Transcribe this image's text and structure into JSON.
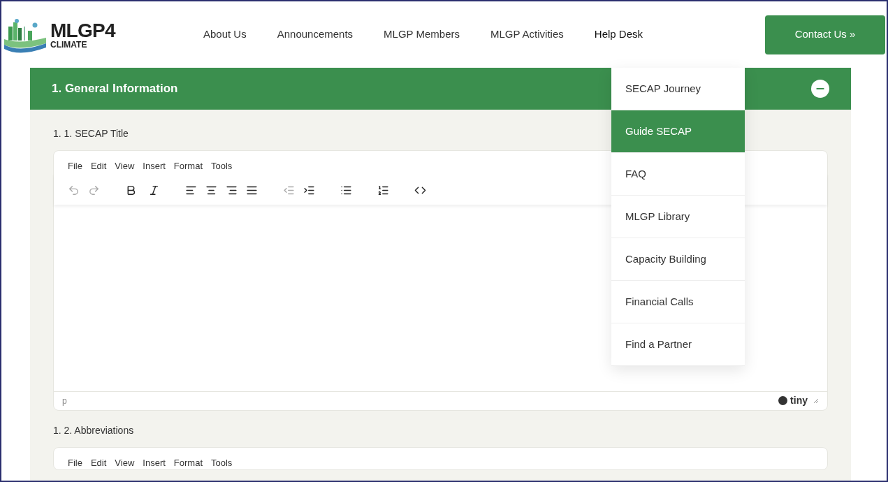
{
  "header": {
    "logo": {
      "title": "MLGP4",
      "subtitle": "CLIMATE"
    },
    "nav": [
      {
        "label": "About Us",
        "selected": false
      },
      {
        "label": "Announcements",
        "selected": false
      },
      {
        "label": "MLGP Members",
        "selected": false
      },
      {
        "label": "MLGP Activities",
        "selected": false
      },
      {
        "label": "Help Desk",
        "selected": true
      }
    ],
    "cta": {
      "label": "Contact Us »"
    }
  },
  "section": {
    "title": "1. General Information",
    "expanded": true
  },
  "fields": [
    {
      "label": "1. 1. SECAP Title",
      "editor": {
        "menu": [
          "File",
          "Edit",
          "View",
          "Insert",
          "Format",
          "Tools"
        ],
        "toolbar": [
          {
            "kind": "undo",
            "disabled": true
          },
          {
            "kind": "redo",
            "disabled": true
          },
          {
            "kind": "bold",
            "disabled": false
          },
          {
            "kind": "italic",
            "disabled": false
          },
          {
            "kind": "align-left",
            "disabled": false
          },
          {
            "kind": "align-center",
            "disabled": false
          },
          {
            "kind": "align-right",
            "disabled": false
          },
          {
            "kind": "align-justify",
            "disabled": false
          },
          {
            "kind": "outdent",
            "disabled": true
          },
          {
            "kind": "indent",
            "disabled": false
          },
          {
            "kind": "bullet-list",
            "disabled": false
          },
          {
            "kind": "number-list",
            "disabled": false
          },
          {
            "kind": "code",
            "disabled": false
          }
        ],
        "path": "p",
        "brand": "tiny"
      }
    },
    {
      "label": "1. 2. Abbreviations",
      "editor": {
        "menu": [
          "File",
          "Edit",
          "View",
          "Insert",
          "Format",
          "Tools"
        ]
      }
    }
  ],
  "dropdown": [
    {
      "label": "SECAP Journey",
      "selected": false
    },
    {
      "label": "Guide SECAP",
      "selected": true
    },
    {
      "label": "FAQ",
      "selected": false
    },
    {
      "label": "MLGP Library",
      "selected": false
    },
    {
      "label": "Capacity Building",
      "selected": false
    },
    {
      "label": "Financial Calls",
      "selected": false
    },
    {
      "label": "Find a Partner",
      "selected": false
    }
  ]
}
